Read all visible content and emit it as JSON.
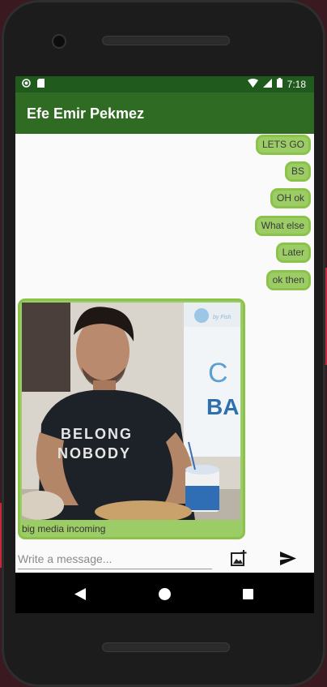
{
  "statusbar": {
    "time": "7:18"
  },
  "appbar": {
    "title": "Efe Emir Pekmez"
  },
  "messages": [
    {
      "text": "LETS GO"
    },
    {
      "text": "BS"
    },
    {
      "text": "OH ok"
    },
    {
      "text": "What else"
    },
    {
      "text": "Later"
    },
    {
      "text": "ok then"
    }
  ],
  "media_message": {
    "caption": "big media incoming",
    "photo": {
      "shirt_lines": [
        "BELONG",
        "NOBODY"
      ],
      "sign_letters": [
        "C",
        "BA"
      ],
      "logo_text": "by Fish"
    }
  },
  "composer": {
    "placeholder": "Write a message...",
    "attach_icon": "add-photo-icon",
    "send_icon": "send-icon"
  },
  "navbar": {
    "back_icon": "back-triangle-icon",
    "home_icon": "home-circle-icon",
    "recents_icon": "recents-square-icon"
  },
  "colors": {
    "statusbar": "#215a1d",
    "appbar": "#2f6b22",
    "bubble": "#9ccc65",
    "bubble_border": "#8bc34a"
  }
}
